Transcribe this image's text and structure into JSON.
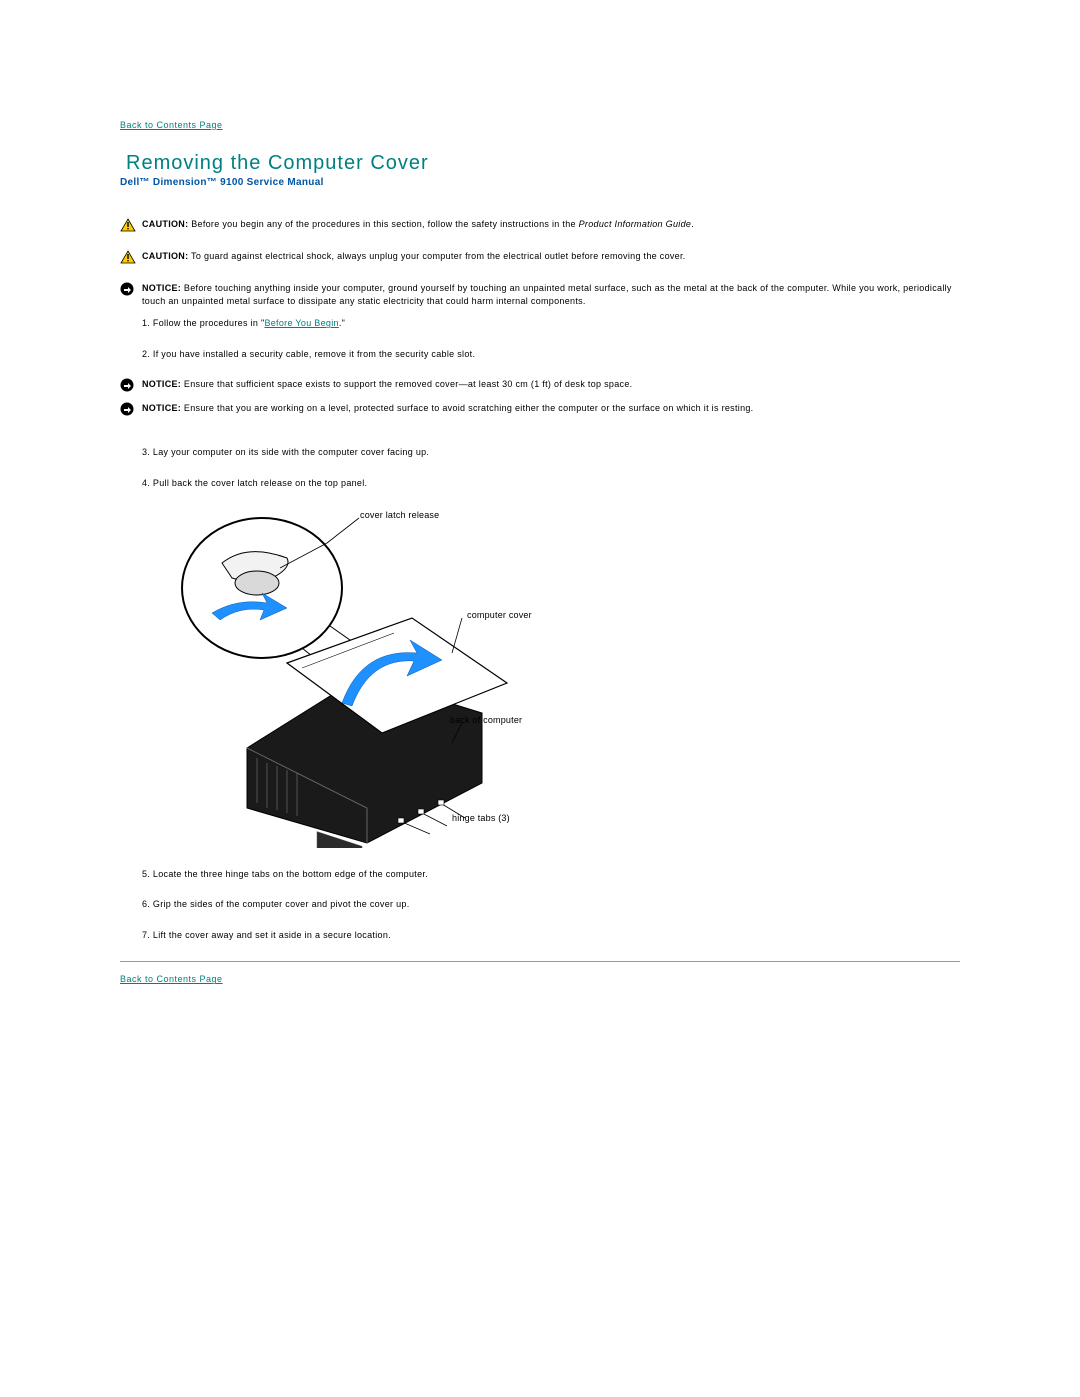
{
  "links": {
    "back_top": "Back to Contents Page",
    "back_bottom": "Back to Contents Page",
    "before_you_begin": "Before You Begin"
  },
  "title": "Removing the Computer Cover",
  "subtitle": "Dell™ Dimension™ 9100 Service Manual",
  "alerts": {
    "caution1": {
      "label": "CAUTION:",
      "text_before": " Before you begin any of the procedures in this section, follow the safety instructions in the ",
      "italic": "Product Information Guide",
      "text_after": "."
    },
    "caution2": {
      "label": "CAUTION:",
      "text": " To guard against electrical shock, always unplug your computer from the electrical outlet before removing the cover."
    },
    "notice1": {
      "label": "NOTICE:",
      "text": " Before touching anything inside your computer, ground yourself by touching an unpainted metal surface, such as the metal at the back of the computer. While you work, periodically touch an unpainted metal surface to dissipate any static electricity that could harm internal components."
    },
    "notice2": {
      "label": "NOTICE:",
      "text": " Ensure that sufficient space exists to support the removed cover—at least 30 cm (1 ft) of desk top space."
    },
    "notice3": {
      "label": "NOTICE:",
      "text": " Ensure that you are working on a level, protected surface to avoid scratching either the computer or the surface on which it is resting."
    }
  },
  "steps": {
    "s1_before": "1.  Follow the procedures in \"",
    "s1_after": ".\"",
    "s2": "2.  If you have installed a security cable, remove it from the security cable slot.",
    "s3": "3.  Lay your computer on its side with the computer cover facing up.",
    "s4": "4.  Pull back the cover latch release on the top panel.",
    "s5": "5.  Locate the three hinge tabs on the bottom edge of the computer.",
    "s6": "6.  Grip the sides of the computer cover and pivot the cover up.",
    "s7": "7.  Lift the cover away and set it aside in a secure location."
  },
  "diagram_labels": {
    "cover_latch": "cover latch release",
    "computer_cover": "computer cover",
    "back_of_computer": "back of computer",
    "hinge_tabs": "hinge tabs (3)"
  }
}
